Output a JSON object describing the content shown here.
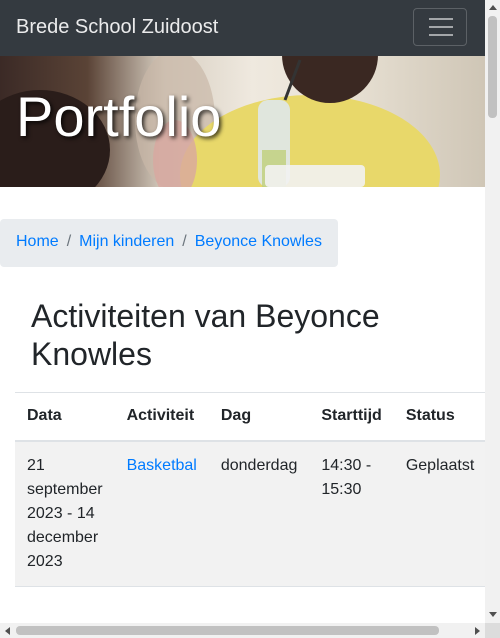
{
  "navbar": {
    "brand": "Brede School Zuidoost",
    "toggle_icon": "hamburger-menu-icon"
  },
  "hero": {
    "title": "Portfolio"
  },
  "breadcrumb": {
    "items": [
      "Home",
      "Mijn kinderen",
      "Beyonce Knowles"
    ]
  },
  "main": {
    "heading": "Activiteiten van Beyonce Knowles"
  },
  "table": {
    "headers": [
      "Data",
      "Activiteit",
      "Dag",
      "Starttijd",
      "Status"
    ],
    "rows": [
      {
        "data": "21 september 2023 - 14 december 2023",
        "activiteit": "Basketbal",
        "dag": "donderdag",
        "starttijd": "14:30 - 15:30",
        "status": "Geplaatst"
      }
    ]
  },
  "colors": {
    "navbar": "#343a40",
    "link": "#007bff",
    "breadcrumb_bg": "#e9ecef",
    "row_bg": "#f2f2f2"
  }
}
